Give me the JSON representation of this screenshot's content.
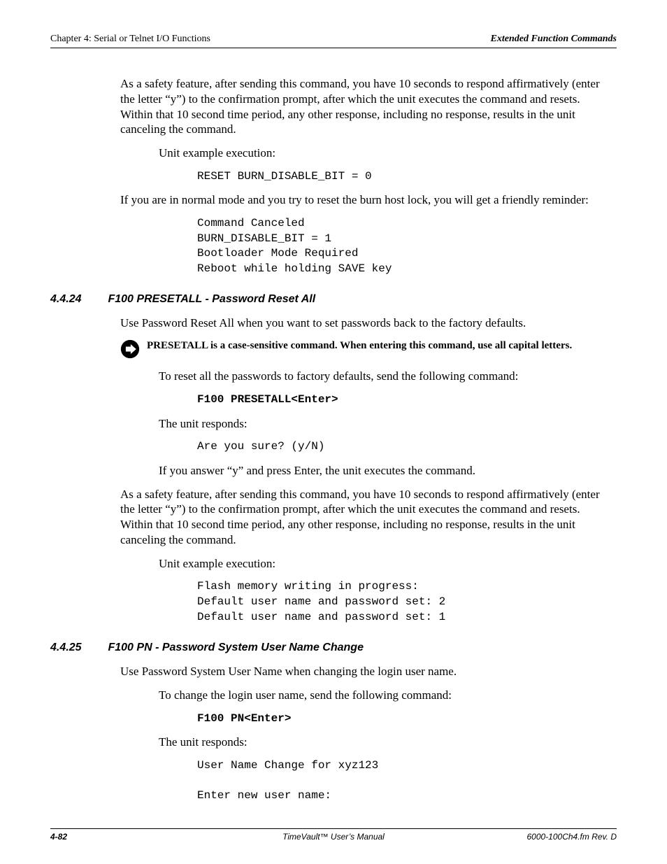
{
  "header": {
    "left": "Chapter 4: Serial or Telnet I/O Functions",
    "right": "Extended Function Commands"
  },
  "intro": {
    "p1": "As a safety feature, after sending this command, you have 10 seconds to respond affirmatively (enter the letter “y”) to the confirmation prompt, after which the unit executes the command and resets.  Within that 10 second time period, any other response, including no response, results in the unit canceling the command.",
    "p2": "Unit example execution:",
    "code1": "RESET BURN_DISABLE_BIT = 0",
    "p3": "If you are in normal mode and you try to reset the burn host lock, you will get a friendly reminder:",
    "code2": "Command Canceled\nBURN_DISABLE_BIT = 1\nBootloader Mode Required\nReboot while holding SAVE key"
  },
  "s4424": {
    "num": "4.4.24",
    "title": "F100 PRESETALL - Password Reset All",
    "p1": "Use Password Reset All when you want to set passwords back to the factory defaults.",
    "note": "PRESETALL is a case-sensitive command.  When entering this command, use all capital letters.",
    "p2": "To reset all the passwords to factory defaults, send the following command:",
    "code1": "F100 PRESETALL<Enter>",
    "p3": "The unit responds:",
    "code2": "Are you sure? (y/N)",
    "p4": "If you answer “y” and press Enter, the unit executes the command.",
    "p5": "As a safety feature, after sending this command, you have 10 seconds to respond affirmatively (enter the letter “y”) to the confirmation prompt, after which the unit executes the command and resets.  Within that 10 second time period, any other response, including no response, results in the unit canceling the command.",
    "p6": "Unit example execution:",
    "code3": "Flash memory writing in progress:\nDefault user name and password set: 2\nDefault user name and password set: 1"
  },
  "s4425": {
    "num": "4.4.25",
    "title": "F100 PN - Password System User Name Change",
    "p1": "Use Password System User Name when changing the login user name.",
    "p2": "To change the login user name, send the following command:",
    "code1": "F100 PN<Enter>",
    "p3": "The unit responds:",
    "code2": "User Name Change for xyz123\n\nEnter new user name:"
  },
  "footer": {
    "left": "4-82",
    "center": "TimeVault™ User’s Manual",
    "right": "6000-100Ch4.fm  Rev. D"
  }
}
